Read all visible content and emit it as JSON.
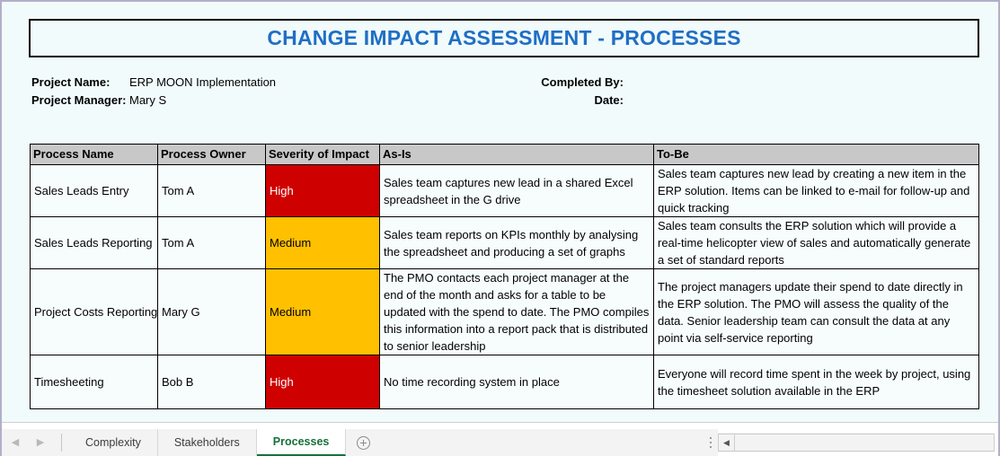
{
  "document": {
    "title": "CHANGE IMPACT ASSESSMENT - PROCESSES"
  },
  "meta": {
    "project_name_label": "Project Name:",
    "project_name_value": "ERP MOON Implementation",
    "project_manager_label": "Project Manager:",
    "project_manager_value": "Mary S",
    "completed_by_label": "Completed By:",
    "completed_by_value": "",
    "date_label": "Date:",
    "date_value": ""
  },
  "table": {
    "headers": [
      "Process Name",
      "Process Owner",
      "Severity of Impact",
      "As-Is",
      "To-Be"
    ],
    "rows": [
      {
        "process_name": "Sales Leads Entry",
        "process_owner": "Tom A",
        "severity": "High",
        "severity_level": "high",
        "as_is": "Sales team captures new lead in a shared Excel spreadsheet in the G drive",
        "to_be": "Sales team captures new lead by creating a new item in the ERP solution. Items can be linked to e-mail for follow-up and quick tracking"
      },
      {
        "process_name": "Sales Leads Reporting",
        "process_owner": "Tom A",
        "severity": "Medium",
        "severity_level": "medium",
        "as_is": "Sales team reports on KPIs monthly by analysing the spreadsheet and producing a set of graphs",
        "to_be": "Sales team consults the ERP solution which will provide a real-time helicopter view of sales and automatically generate a set of standard reports"
      },
      {
        "process_name": "Project Costs Reporting",
        "process_owner": "Mary G",
        "severity": "Medium",
        "severity_level": "medium",
        "as_is": "The PMO contacts each project manager at the end of the month and asks for a table to be updated with the spend to date. The PMO compiles this information into a report pack that is distributed to senior leadership",
        "to_be": "The project managers update their spend to date directly in the ERP solution. The PMO will assess the quality of the data. Senior leadership team can consult the data at any point via self-service reporting"
      },
      {
        "process_name": "Timesheeting",
        "process_owner": "Bob B",
        "severity": "High",
        "severity_level": "high",
        "as_is": "No time recording system in place",
        "to_be": "Everyone will record time spent in the week by project, using the timesheet solution available in the ERP"
      }
    ]
  },
  "sheet_tabs": {
    "prev_label": "◀",
    "next_label": "▶",
    "items": [
      {
        "label": "Complexity",
        "active": false
      },
      {
        "label": "Stakeholders",
        "active": false
      },
      {
        "label": "Processes",
        "active": true
      }
    ],
    "add_sheet_label": "+"
  },
  "scrollbar": {
    "left_arrow_label": "◀"
  },
  "colors": {
    "title_blue": "#1f6fc4",
    "severity_high": "#cf0000",
    "severity_medium": "#ffc000",
    "header_gray": "#c8c8c8",
    "active_tab_green": "#15713c",
    "page_background": "#f1fbfc"
  }
}
